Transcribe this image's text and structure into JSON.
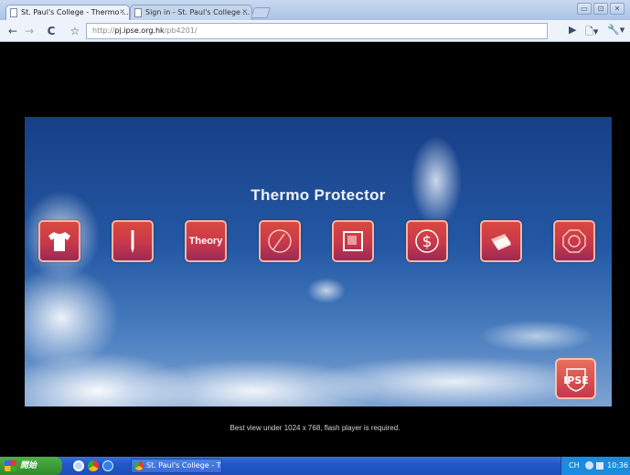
{
  "browser": {
    "tabs": [
      {
        "title": "St. Paul's College - Thermo ...",
        "active": true
      },
      {
        "title": "Sign in - St. Paul's College ...",
        "active": false
      }
    ],
    "close_glyph": "×",
    "url_scheme": "http://",
    "url_host": "pj.ipse.org.hk",
    "url_path": "/pb4201/",
    "nav": {
      "back": "←",
      "forward": "→",
      "reload": "C",
      "star": "☆"
    },
    "right_buttons": {
      "play": "▶",
      "page": "🗋▾",
      "tools": "🔧▾"
    },
    "window_buttons": [
      "▭",
      "⊡",
      "✕"
    ]
  },
  "flash": {
    "title": "Thermo Protector",
    "icons": [
      {
        "name": "tshirt-icon"
      },
      {
        "name": "pencil-icon"
      },
      {
        "name": "theory-icon",
        "label": "Theory"
      },
      {
        "name": "gauge-icon"
      },
      {
        "name": "square-frame-icon"
      },
      {
        "name": "dollar-icon"
      },
      {
        "name": "papers-icon"
      },
      {
        "name": "octagon-target-icon"
      }
    ],
    "logo_icon": "ipse-logo",
    "footer_note": "Best view under 1024 x 768, flash player is required."
  },
  "taskbar": {
    "start_label": "開始",
    "task_item": "St. Paul's College - Th...",
    "tray_lang": "CH",
    "tray_time": "10:36"
  },
  "colors": {
    "icon_tile": "#c8384a",
    "icon_border": "#f4b6a8",
    "sky_top": "#173f86",
    "taskbar": "#2256c7"
  }
}
